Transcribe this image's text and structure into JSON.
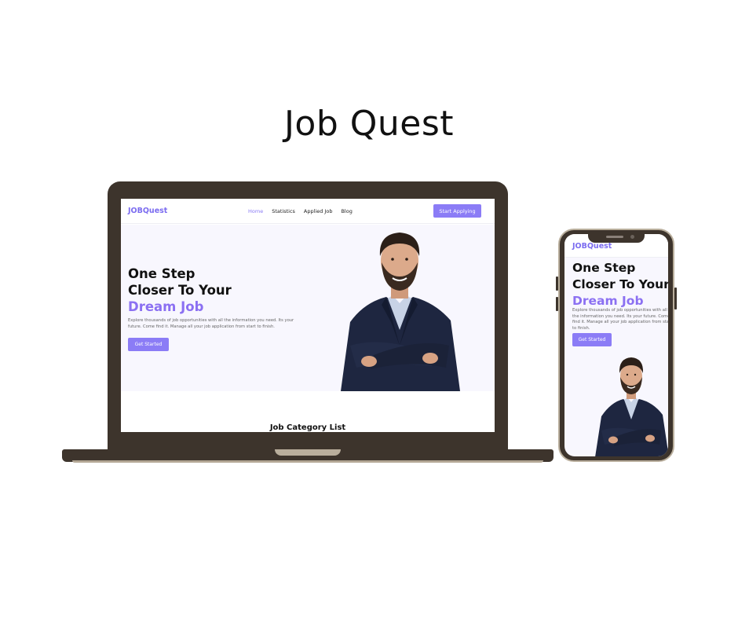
{
  "page": {
    "title": "Job Quest"
  },
  "site": {
    "logo": "JOBQuest",
    "nav": [
      {
        "label": "Home",
        "active": true
      },
      {
        "label": "Statistics",
        "active": false
      },
      {
        "label": "Applied Job",
        "active": false
      },
      {
        "label": "Blog",
        "active": false
      }
    ],
    "cta_label": "Start Applying",
    "hero": {
      "line1": "One Step",
      "line2": "Closer To Your",
      "line3": "Dream Job",
      "description": "Explore thousands of job opportunities with all the information you need. Its your future. Come find it. Manage all your job application from start to finish.",
      "button_label": "Get Started"
    },
    "section_title": "Job Category List"
  },
  "colors": {
    "accent": "#8b7cf6",
    "device_frame": "#3d342c",
    "hero_background": "#f8f7fe"
  },
  "icons": {
    "hero_image": "man-crossed-arms-photo"
  }
}
